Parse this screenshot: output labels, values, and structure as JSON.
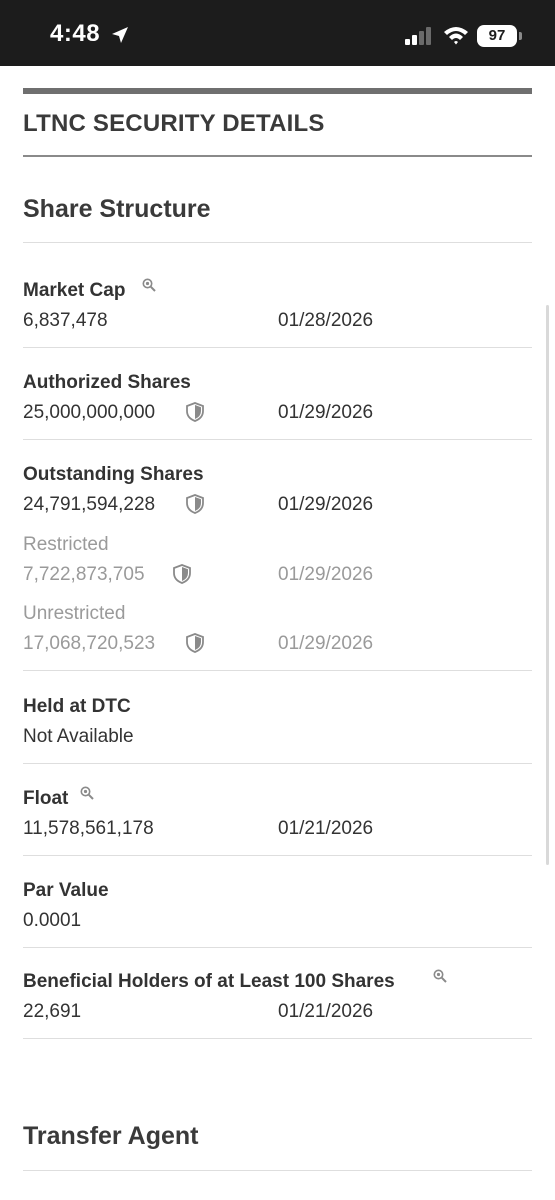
{
  "status_bar": {
    "time": "4:48",
    "battery": "97"
  },
  "page": {
    "title": "LTNC SECURITY DETAILS"
  },
  "sections": {
    "share_structure": "Share Structure",
    "transfer_agent": "Transfer Agent"
  },
  "rows": {
    "market_cap": {
      "label": "Market Cap",
      "value": "6,837,478",
      "date": "01/28/2026"
    },
    "authorized": {
      "label": "Authorized Shares",
      "value": "25,000,000,000",
      "date": "01/29/2026"
    },
    "outstanding": {
      "label": "Outstanding Shares",
      "value": "24,791,594,228",
      "date": "01/29/2026"
    },
    "restricted": {
      "label": "Restricted",
      "value": "7,722,873,705",
      "date": "01/29/2026"
    },
    "unrestricted": {
      "label": "Unrestricted",
      "value": "17,068,720,523",
      "date": "01/29/2026"
    },
    "held_dtc": {
      "label": "Held at DTC",
      "value": "Not Available"
    },
    "float": {
      "label": "Float",
      "value": "11,578,561,178",
      "date": "01/21/2026"
    },
    "par_value": {
      "label": "Par Value",
      "value": "0.0001"
    },
    "beneficial": {
      "label": "Beneficial Holders of at Least 100 Shares",
      "value": "22,691",
      "date": "01/21/2026"
    }
  },
  "icons": {
    "zoom": "magnifier-icon",
    "verified": "shield-icon",
    "location": "location-arrow-icon"
  },
  "colors": {
    "status_bar": "#1c1c1c",
    "muted_text": "#9a9a9a",
    "divider": "#dedede"
  }
}
